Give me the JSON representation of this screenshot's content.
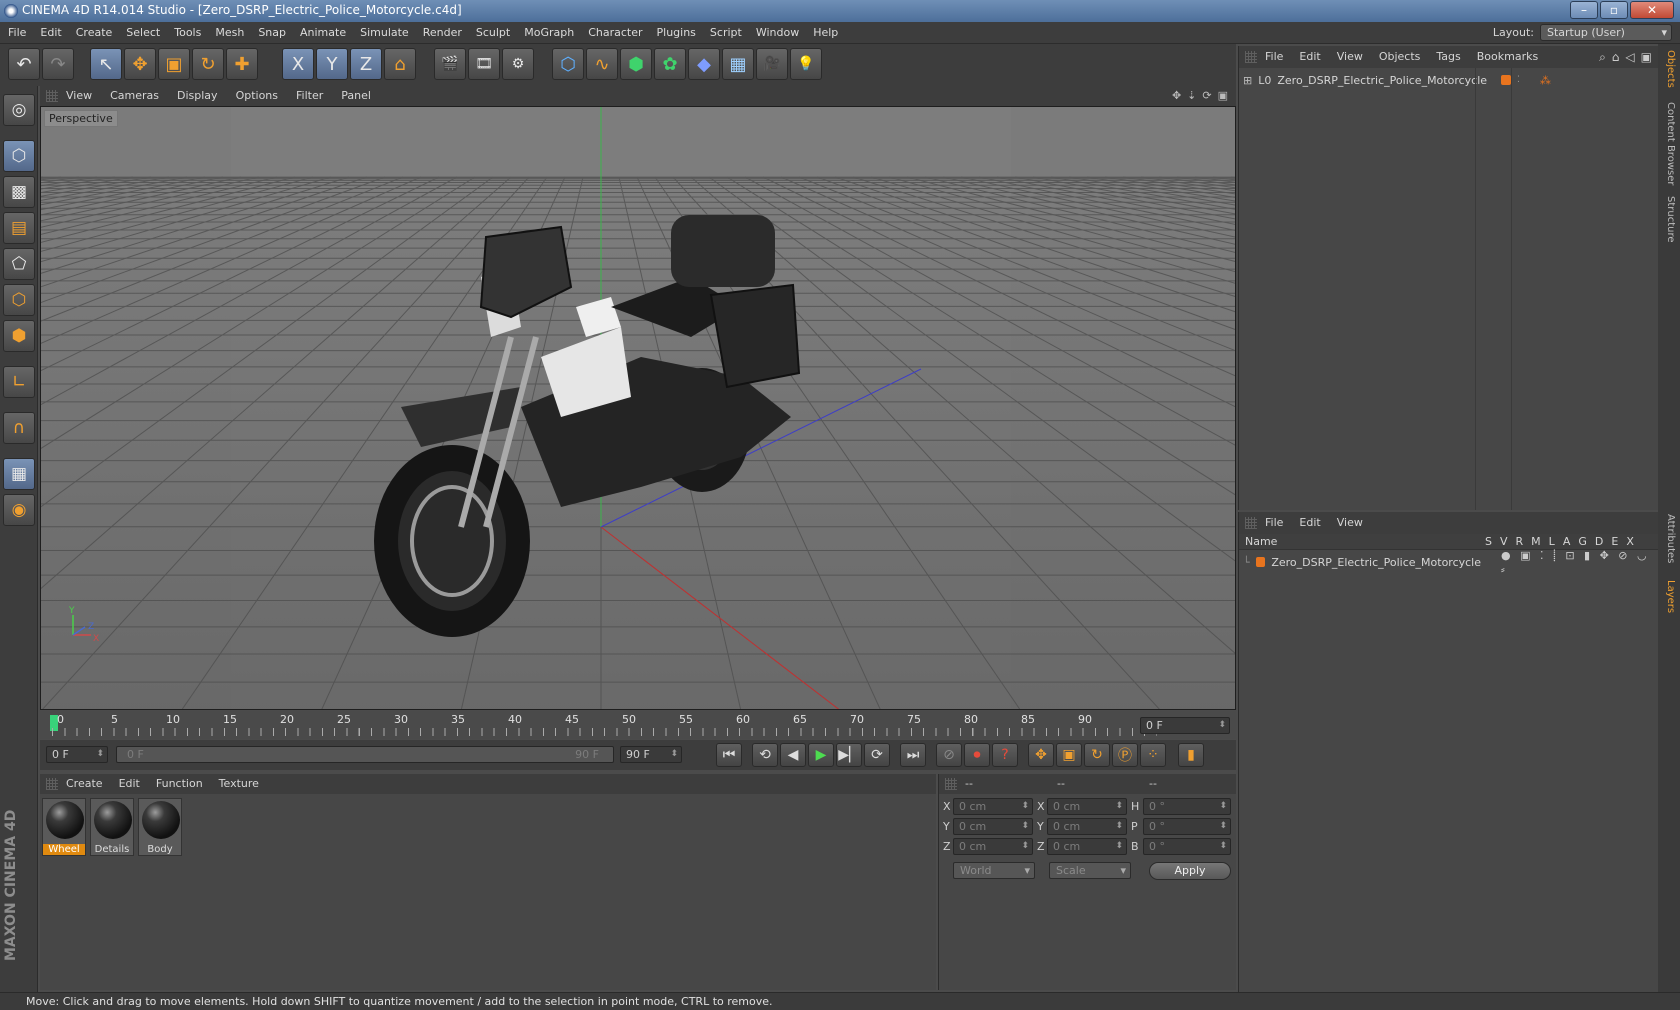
{
  "window": {
    "title": "CINEMA 4D R14.014 Studio - [Zero_DSRP_Electric_Police_Motorcycle.c4d]",
    "buttons": [
      "–",
      "▫",
      "✕"
    ]
  },
  "menubar": {
    "items": [
      "File",
      "Edit",
      "Create",
      "Select",
      "Tools",
      "Mesh",
      "Snap",
      "Animate",
      "Simulate",
      "Render",
      "Sculpt",
      "MoGraph",
      "Character",
      "Plugins",
      "Script",
      "Window",
      "Help"
    ],
    "layout_label": "Layout:",
    "layout_value": "Startup (User)"
  },
  "toolbar": {
    "icons": [
      "undo-icon",
      "redo-icon",
      "live-selection-icon",
      "move-icon",
      "scale-icon",
      "rotate-icon",
      "last-tool-icon",
      "x-axis-icon",
      "y-axis-icon",
      "z-axis-icon",
      "coordinate-system-icon",
      "render-view-icon",
      "render-picture-viewer-icon",
      "edit-render-settings-icon",
      "cube-icon",
      "spline-icon",
      "nurbs-icon",
      "mograph-cloner-icon",
      "deformer-icon",
      "floor-icon",
      "camera-icon",
      "light-icon"
    ],
    "glyphs": [
      "↶",
      "↷",
      "↖",
      "✥",
      "▣",
      "↻",
      "✚",
      "X",
      "Y",
      "Z",
      "⌂",
      "🎬",
      "🎞",
      "⚙",
      "⬡",
      "∿",
      "⬢",
      "✿",
      "◆",
      "▦",
      "🎥",
      "💡"
    ]
  },
  "leftcol": {
    "icons": [
      "make-editable-icon",
      "model-mode-icon",
      "texture-mode-icon",
      "workplane-icon",
      "points-mode-icon",
      "edges-mode-icon",
      "polygons-mode-icon",
      "axis-mode-icon",
      "magnet-icon",
      "locked-workplane-icon",
      "soft-selection-icon"
    ],
    "glyphs": [
      "◎",
      "⬡",
      "▩",
      "▤",
      "⬠",
      "⬡",
      "⬢",
      "∟",
      "∩",
      "▦",
      "◉"
    ],
    "brand": "MAXON CINEMA 4D"
  },
  "viewport": {
    "menu": [
      "View",
      "Cameras",
      "Display",
      "Options",
      "Filter",
      "Panel"
    ],
    "label": "Perspective",
    "axis_labels": {
      "y": "Y",
      "z": "Z",
      "x": "X"
    }
  },
  "timeline": {
    "ticks": [
      "0",
      "5",
      "10",
      "15",
      "20",
      "25",
      "30",
      "35",
      "40",
      "45",
      "50",
      "55",
      "60",
      "65",
      "70",
      "75",
      "80",
      "85",
      "90"
    ],
    "current_frame": "0 F"
  },
  "transport": {
    "start_field": "0 F",
    "range_start": "0 F",
    "range_end": "90 F",
    "end_field": "90 F"
  },
  "materials": {
    "menu": [
      "Create",
      "Edit",
      "Function",
      "Texture"
    ],
    "items": [
      {
        "name": "Wheel",
        "selected": true
      },
      {
        "name": "Details",
        "selected": false
      },
      {
        "name": "Body",
        "selected": false
      }
    ]
  },
  "coordinates": {
    "headers": [
      "--",
      "--",
      "--"
    ],
    "rows": [
      {
        "a": "X",
        "av": "0 cm",
        "b": "X",
        "bv": "0 cm",
        "c": "H",
        "cv": "0 °"
      },
      {
        "a": "Y",
        "av": "0 cm",
        "b": "Y",
        "bv": "0 cm",
        "c": "P",
        "cv": "0 °"
      },
      {
        "a": "Z",
        "av": "0 cm",
        "b": "Z",
        "bv": "0 cm",
        "c": "B",
        "cv": "0 °"
      }
    ],
    "world": "World",
    "scale": "Scale",
    "apply": "Apply"
  },
  "objects_panel": {
    "menu": [
      "File",
      "Edit",
      "View",
      "Objects",
      "Tags",
      "Bookmarks"
    ],
    "object_name": "Zero_DSRP_Electric_Police_Motorcycle"
  },
  "layers_panel": {
    "menu": [
      "File",
      "Edit",
      "View"
    ],
    "name_header": "Name",
    "columns": [
      "S",
      "V",
      "R",
      "M",
      "L",
      "A",
      "G",
      "D",
      "E",
      "X"
    ],
    "layer_name": "Zero_DSRP_Electric_Police_Motorcycle"
  },
  "vtabs": [
    "Objects",
    "Content Browser",
    "Structure",
    "Attributes",
    "Layers"
  ],
  "status": "Move: Click and drag to move elements. Hold down SHIFT to quantize movement / add to the selection in point mode, CTRL to remove."
}
